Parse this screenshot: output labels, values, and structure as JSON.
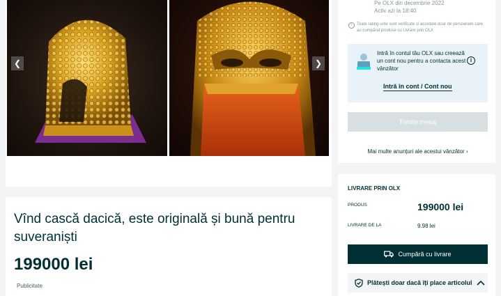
{
  "seller": {
    "since": "Pe OLX din decembrie 2022",
    "active": "Activ azi la 18:40",
    "ratings_note": "Toate rating-urile sunt verificate și acordate doar de persoanele care au cumpărat produse cu Livrare prin OLX",
    "login_prompt": "Intră în contul tău OLX sau creează un cont nou pentru a contacta acest vânzător",
    "login_link": "Intră în cont / Cont nou",
    "send_message": "Trimite mesaj",
    "more_ads": "Mai multe anunțuri ale acestui vânzător"
  },
  "listing": {
    "title": "Vînd cască dacică, este originală și bună pentru suveraniști",
    "price": "199000 lei",
    "published_label": "Publicitate"
  },
  "delivery": {
    "heading": "LIVRARE PRIN OLX",
    "product_label": "PRODUS",
    "product_value": "199000 lei",
    "shipping_label": "LIVRARE DE LA",
    "shipping_value": "9.98 lei",
    "buy_button": "Cumpără cu livrare",
    "pay_note": "Plătești doar dacă îți place articolul"
  },
  "gallery": {
    "prev_icon": "chevron-left-icon",
    "next_icon": "chevron-right-icon",
    "image_subject": "golden-helmet-photos"
  },
  "colors": {
    "brand_dark": "#002f34",
    "gold": "#d9a21f",
    "purple": "#7b2d8f",
    "login_bg": "#e9f2f8",
    "disabled_button": "#d8dfe0",
    "page_bg": "#f2f4f5"
  }
}
